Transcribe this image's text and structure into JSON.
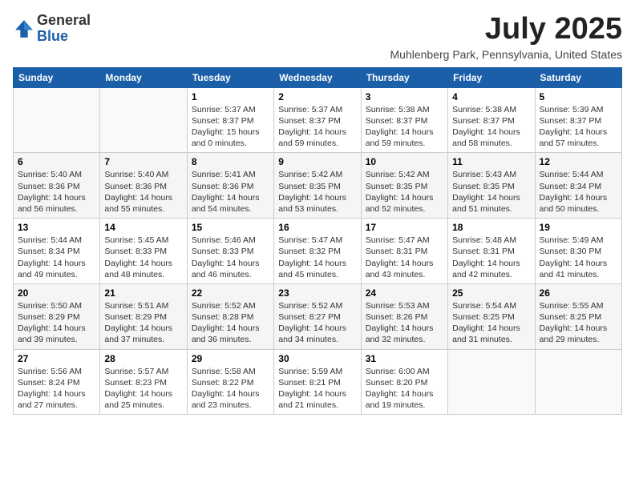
{
  "header": {
    "logo_line1": "General",
    "logo_line2": "Blue",
    "month": "July 2025",
    "location": "Muhlenberg Park, Pennsylvania, United States"
  },
  "weekdays": [
    "Sunday",
    "Monday",
    "Tuesday",
    "Wednesday",
    "Thursday",
    "Friday",
    "Saturday"
  ],
  "weeks": [
    [
      {
        "day": "",
        "info": ""
      },
      {
        "day": "",
        "info": ""
      },
      {
        "day": "1",
        "info": "Sunrise: 5:37 AM\nSunset: 8:37 PM\nDaylight: 15 hours and 0 minutes."
      },
      {
        "day": "2",
        "info": "Sunrise: 5:37 AM\nSunset: 8:37 PM\nDaylight: 14 hours and 59 minutes."
      },
      {
        "day": "3",
        "info": "Sunrise: 5:38 AM\nSunset: 8:37 PM\nDaylight: 14 hours and 59 minutes."
      },
      {
        "day": "4",
        "info": "Sunrise: 5:38 AM\nSunset: 8:37 PM\nDaylight: 14 hours and 58 minutes."
      },
      {
        "day": "5",
        "info": "Sunrise: 5:39 AM\nSunset: 8:37 PM\nDaylight: 14 hours and 57 minutes."
      }
    ],
    [
      {
        "day": "6",
        "info": "Sunrise: 5:40 AM\nSunset: 8:36 PM\nDaylight: 14 hours and 56 minutes."
      },
      {
        "day": "7",
        "info": "Sunrise: 5:40 AM\nSunset: 8:36 PM\nDaylight: 14 hours and 55 minutes."
      },
      {
        "day": "8",
        "info": "Sunrise: 5:41 AM\nSunset: 8:36 PM\nDaylight: 14 hours and 54 minutes."
      },
      {
        "day": "9",
        "info": "Sunrise: 5:42 AM\nSunset: 8:35 PM\nDaylight: 14 hours and 53 minutes."
      },
      {
        "day": "10",
        "info": "Sunrise: 5:42 AM\nSunset: 8:35 PM\nDaylight: 14 hours and 52 minutes."
      },
      {
        "day": "11",
        "info": "Sunrise: 5:43 AM\nSunset: 8:35 PM\nDaylight: 14 hours and 51 minutes."
      },
      {
        "day": "12",
        "info": "Sunrise: 5:44 AM\nSunset: 8:34 PM\nDaylight: 14 hours and 50 minutes."
      }
    ],
    [
      {
        "day": "13",
        "info": "Sunrise: 5:44 AM\nSunset: 8:34 PM\nDaylight: 14 hours and 49 minutes."
      },
      {
        "day": "14",
        "info": "Sunrise: 5:45 AM\nSunset: 8:33 PM\nDaylight: 14 hours and 48 minutes."
      },
      {
        "day": "15",
        "info": "Sunrise: 5:46 AM\nSunset: 8:33 PM\nDaylight: 14 hours and 46 minutes."
      },
      {
        "day": "16",
        "info": "Sunrise: 5:47 AM\nSunset: 8:32 PM\nDaylight: 14 hours and 45 minutes."
      },
      {
        "day": "17",
        "info": "Sunrise: 5:47 AM\nSunset: 8:31 PM\nDaylight: 14 hours and 43 minutes."
      },
      {
        "day": "18",
        "info": "Sunrise: 5:48 AM\nSunset: 8:31 PM\nDaylight: 14 hours and 42 minutes."
      },
      {
        "day": "19",
        "info": "Sunrise: 5:49 AM\nSunset: 8:30 PM\nDaylight: 14 hours and 41 minutes."
      }
    ],
    [
      {
        "day": "20",
        "info": "Sunrise: 5:50 AM\nSunset: 8:29 PM\nDaylight: 14 hours and 39 minutes."
      },
      {
        "day": "21",
        "info": "Sunrise: 5:51 AM\nSunset: 8:29 PM\nDaylight: 14 hours and 37 minutes."
      },
      {
        "day": "22",
        "info": "Sunrise: 5:52 AM\nSunset: 8:28 PM\nDaylight: 14 hours and 36 minutes."
      },
      {
        "day": "23",
        "info": "Sunrise: 5:52 AM\nSunset: 8:27 PM\nDaylight: 14 hours and 34 minutes."
      },
      {
        "day": "24",
        "info": "Sunrise: 5:53 AM\nSunset: 8:26 PM\nDaylight: 14 hours and 32 minutes."
      },
      {
        "day": "25",
        "info": "Sunrise: 5:54 AM\nSunset: 8:25 PM\nDaylight: 14 hours and 31 minutes."
      },
      {
        "day": "26",
        "info": "Sunrise: 5:55 AM\nSunset: 8:25 PM\nDaylight: 14 hours and 29 minutes."
      }
    ],
    [
      {
        "day": "27",
        "info": "Sunrise: 5:56 AM\nSunset: 8:24 PM\nDaylight: 14 hours and 27 minutes."
      },
      {
        "day": "28",
        "info": "Sunrise: 5:57 AM\nSunset: 8:23 PM\nDaylight: 14 hours and 25 minutes."
      },
      {
        "day": "29",
        "info": "Sunrise: 5:58 AM\nSunset: 8:22 PM\nDaylight: 14 hours and 23 minutes."
      },
      {
        "day": "30",
        "info": "Sunrise: 5:59 AM\nSunset: 8:21 PM\nDaylight: 14 hours and 21 minutes."
      },
      {
        "day": "31",
        "info": "Sunrise: 6:00 AM\nSunset: 8:20 PM\nDaylight: 14 hours and 19 minutes."
      },
      {
        "day": "",
        "info": ""
      },
      {
        "day": "",
        "info": ""
      }
    ]
  ]
}
